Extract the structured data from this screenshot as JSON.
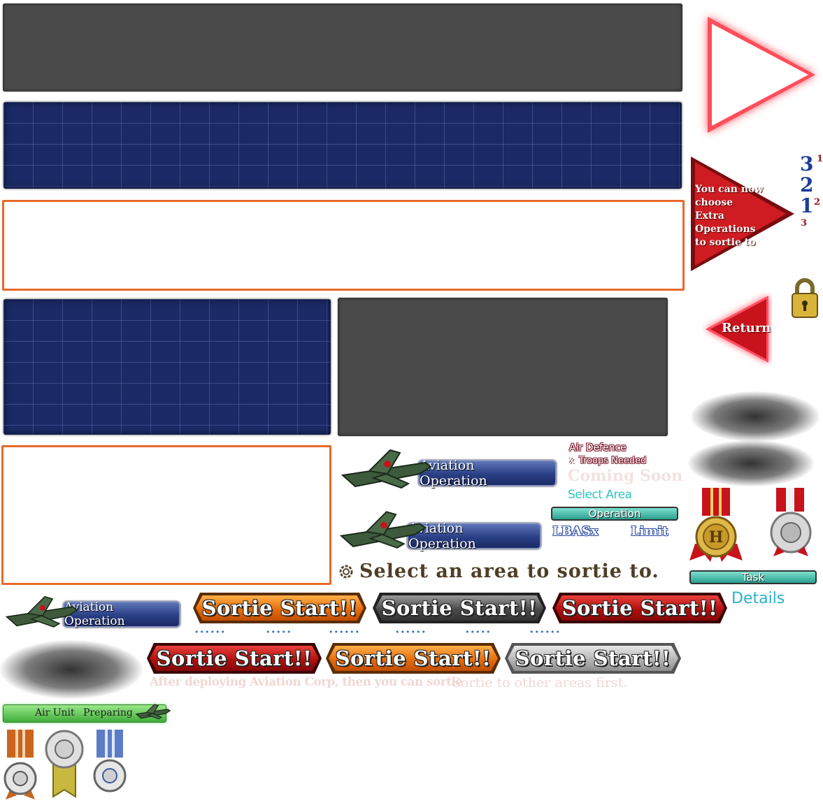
{
  "extra_ops_banner": {
    "text": "You can now choose Extra Operations to sortie to"
  },
  "return_button": {
    "label": "Return"
  },
  "rank_digits": {
    "big": [
      "3",
      "2",
      "1"
    ],
    "small": [
      "1",
      "2",
      "3"
    ]
  },
  "aviation": {
    "label": "Aviation Operation"
  },
  "labels": {
    "air_defence": "Air Defence",
    "times": "x",
    "troops_needed": "Troops Needed",
    "coming_soon": "Coming Soon",
    "select_area": "Select Area",
    "operation": "Operation",
    "lbas": "LBASx",
    "limit": "Limit",
    "task": "Task",
    "details": "Details",
    "select_sortie": "Select an area to sortie to.",
    "after_deploy": "After deploying Aviation Corp, then you can sortie",
    "sortie_other": "Sortie to other areas first.",
    "air_unit": "Air Unit",
    "preparing": "Preparing"
  },
  "sortie": {
    "label": "Sortie Start!!"
  },
  "colors": {
    "panel_gray": "#4b4b4b",
    "panel_navy": "#1b2a66",
    "outline_orange": "#e8692a",
    "accent_red": "#c0121a",
    "teal": "#2aa090"
  }
}
